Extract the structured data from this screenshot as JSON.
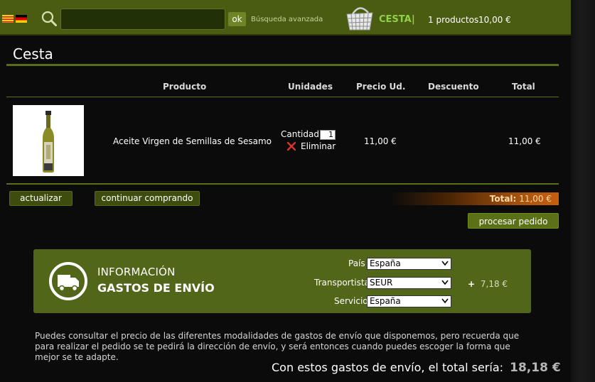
{
  "header": {
    "search": {
      "value": "",
      "placeholder": ""
    },
    "ok_label": "ok",
    "advanced_search": "Búsqueda avanzada",
    "cart_label": "CESTA",
    "cart_separator": "|",
    "cart_count": "1 productos",
    "cart_total": "10,00 €"
  },
  "page": {
    "title": "Cesta"
  },
  "table": {
    "headers": {
      "product": "Producto",
      "units": "Unidades",
      "unit_price": "Precio Ud.",
      "discount": "Descuento",
      "total": "Total"
    },
    "rows": [
      {
        "product_name": "Aceite Virgen de Semillas de Sesamo",
        "quantity_label": "Cantidad:",
        "quantity": "1",
        "remove_label": "Eliminar",
        "unit_price": "11,00 €",
        "discount": "",
        "total": "11,00 €"
      }
    ]
  },
  "actions": {
    "update": "actualizar",
    "continue": "continuar comprando",
    "total_label": "Total:",
    "total_value": "11,00 €",
    "process": "procesar pedido"
  },
  "shipping": {
    "title_line1": "INFORMACIÓN",
    "title_line2": "GASTOS DE ENVÍO",
    "country_label": "País",
    "country_value": "España",
    "carrier_label": "Transportista",
    "carrier_value": "SEUR",
    "service_label": "Servicio",
    "service_value": "España",
    "cost_prefix": "+",
    "cost_value": "7,18 €"
  },
  "note": "Puedes consultar el precio de las diferentes modalidades de gastos de envío que disponemos, pero recuerda que para realizar el pedido se te pedirá la dirección de envío, y será entonces cuando puedes escoger la forma que mejor se te adapte.",
  "final": {
    "label": "Con estos gastos de envío, el total sería:",
    "value": "18,18 €"
  },
  "colors": {
    "header_bg": "#4a5c12",
    "accent_green": "#8fd148",
    "shipping_box": "#52661a",
    "total_bar_orange": "#c7600f"
  }
}
